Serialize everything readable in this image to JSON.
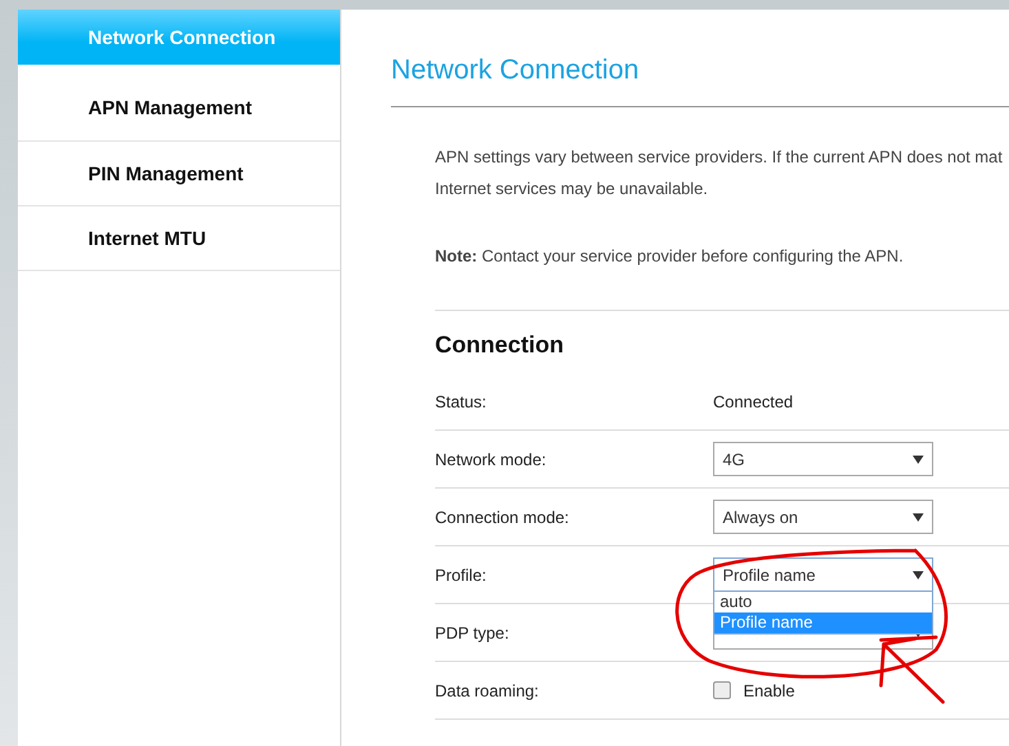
{
  "sidebar": {
    "items": [
      {
        "label": "Network Connection",
        "selected": true
      },
      {
        "label": "APN Management",
        "selected": false
      },
      {
        "label": "PIN Management",
        "selected": false
      },
      {
        "label": "Internet MTU",
        "selected": false
      }
    ]
  },
  "page_title": "Network Connection",
  "intro_lines": [
    "APN settings vary between service providers. If the current APN does not mat",
    "Internet services may be unavailable."
  ],
  "note": "**Note:** Contact your service provider before configuring the APN.",
  "section_title": "Connection",
  "rows": [
    {
      "kind": "text",
      "label": "Status:",
      "value": "Connected"
    },
    {
      "kind": "select",
      "label": "Network mode:",
      "value": "4G"
    },
    {
      "kind": "select",
      "label": "Connection mode:",
      "value": "Always on"
    },
    {
      "kind": "select",
      "label": "Profile:",
      "value": "Profile name",
      "expanded": true,
      "options": [
        {
          "label": "auto",
          "selected": false
        },
        {
          "label": "Profile name",
          "selected": true
        }
      ]
    },
    {
      "kind": "select",
      "label": "PDP type:"
    },
    {
      "kind": "checkbox",
      "label": "Data roaming:",
      "value": "Enable",
      "checked": false
    }
  ]
}
